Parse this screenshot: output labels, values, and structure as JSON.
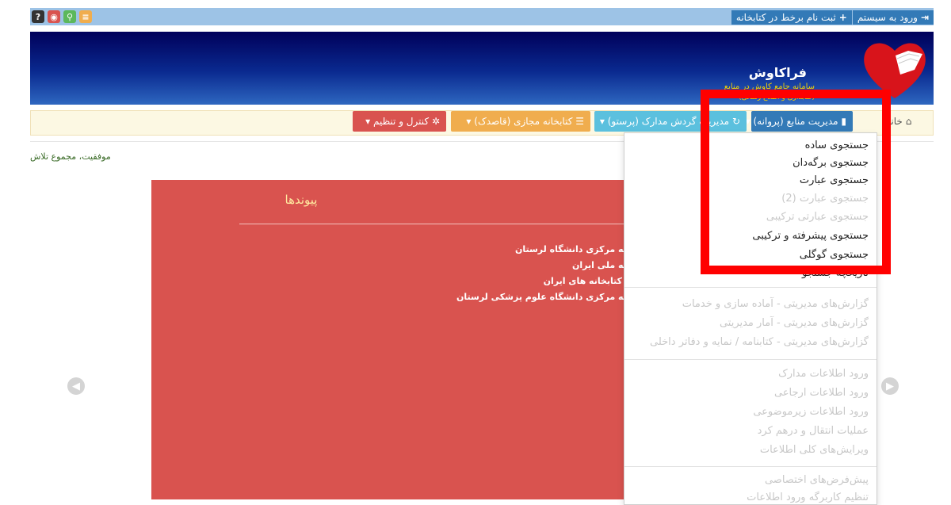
{
  "quick_icons": [
    {
      "name": "help-icon",
      "glyph": "?"
    },
    {
      "name": "globe-icon",
      "glyph": "◉"
    },
    {
      "name": "search-icon",
      "glyph": "⚲"
    },
    {
      "name": "list-icon",
      "glyph": "≡"
    }
  ],
  "auth": {
    "login_label": "ورود به سیستم",
    "register_label": "ثبت نام برخط در کتابخانه"
  },
  "banner": {
    "title": "فراکاوش",
    "subtitle": "سامانه جامع کاوش در منابع",
    "tagline": "(کتابداری و اطلاع رسانی)"
  },
  "nav": {
    "home_label": "خانه",
    "resources_label": "مدیریت منابع (پروانه)",
    "circulation_label": "مدیریت گردش مدارک (پرستو)",
    "virtual_label": "کتابخانه مجازی (قاصدک)",
    "control_label": "کنترل و تنظیم"
  },
  "breadcrumb": "موفقیت، مجموع تلاش",
  "panel": {
    "title": "پیوندها",
    "links": [
      "کتابخانه مرکزی دانشگاه لرستان",
      "کتابخانه ملی ایران",
      "انجمن کتابخانه های ایران",
      "کتابخانه مرکزی دانشگاه علوم پزشکی لرستان"
    ]
  },
  "dropdown": {
    "items": [
      {
        "label": "جستجوی ساده",
        "enabled": true
      },
      {
        "label": "جستجوی برگه‌دان",
        "enabled": true
      },
      {
        "label": "جستجوی عبارت",
        "enabled": true
      },
      {
        "label": "جستجوی عبارت (2)",
        "enabled": false
      },
      {
        "label": "جستجوی عبارتی ترکیبی",
        "enabled": false
      },
      {
        "label": "جستجوی پیشرفته و ترکیبی",
        "enabled": true
      },
      {
        "label": "جستجوی گوگلی",
        "enabled": true
      },
      {
        "label": "تاریخچه جستجو",
        "enabled": true
      },
      {
        "label": "گزارش‌های مدیریتی - آماده سازی و خدمات",
        "enabled": false
      },
      {
        "label": "گزارش‌های مدیریتی - آمار مدیریتی",
        "enabled": false
      },
      {
        "label": "گزارش‌های مدیریتی - کتابنامه / نمایه و دفاتر داخلی",
        "enabled": false
      },
      {
        "label": "ورود اطلاعات مدارک",
        "enabled": false
      },
      {
        "label": "ورود اطلاعات ارجاعی",
        "enabled": false
      },
      {
        "label": "ورود اطلاعات زیرموضوعی",
        "enabled": false
      },
      {
        "label": "عملیات انتقال و درهم کرد",
        "enabled": false
      },
      {
        "label": "ویرایش‌های کلی اطلاعات",
        "enabled": false
      },
      {
        "label": "پیش‌فرض‌های اختصاصی",
        "enabled": false
      },
      {
        "label": "تنظیم کاربرگه ورود اطلاعات",
        "enabled": false
      }
    ]
  },
  "colors": {
    "primary": "#337ab7",
    "info": "#5bc0de",
    "warning": "#f0ad4e",
    "danger": "#d9534f",
    "highlight": "#ff0000"
  }
}
